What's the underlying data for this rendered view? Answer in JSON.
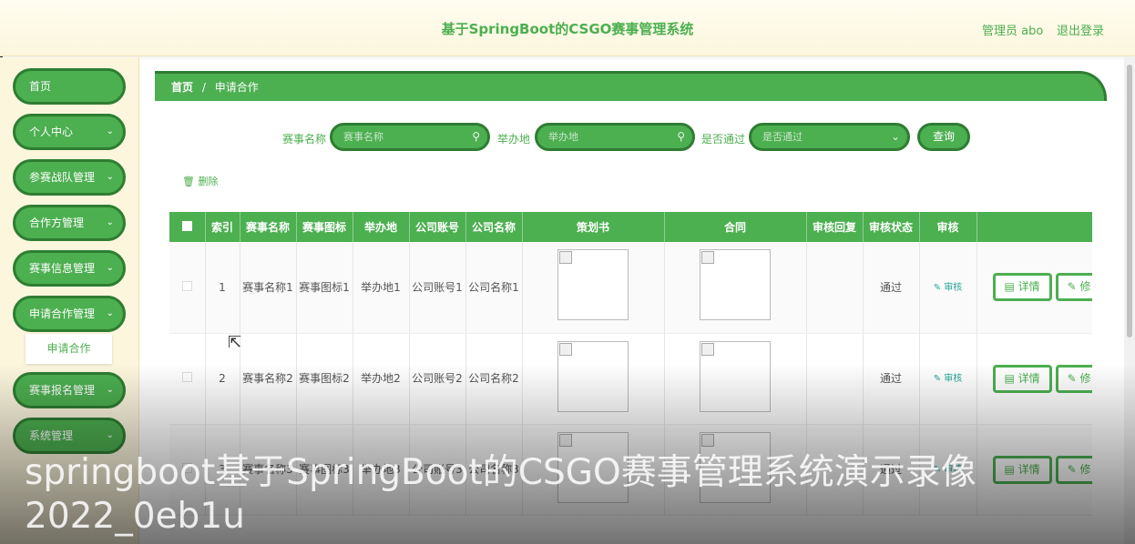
{
  "header": {
    "title": "基于SpringBoot的CSGO赛事管理系统",
    "user": "管理员 abo",
    "logout": "退出登录"
  },
  "sidebar": {
    "items": [
      {
        "label": "首页",
        "chevron": ""
      },
      {
        "label": "个人中心",
        "chevron": "⌄"
      },
      {
        "label": "参赛战队管理",
        "chevron": "⌄"
      },
      {
        "label": "合作方管理",
        "chevron": "⌄"
      },
      {
        "label": "赛事信息管理",
        "chevron": "⌄"
      },
      {
        "label": "申请合作管理",
        "chevron": "⌄"
      },
      {
        "label": "赛事报名管理",
        "chevron": "⌄"
      },
      {
        "label": "系统管理",
        "chevron": "⌄"
      }
    ],
    "submenu_active": "申请合作"
  },
  "breadcrumb": {
    "home": "首页",
    "sep": "/",
    "current": "申请合作"
  },
  "filters": {
    "event_name_label": "赛事名称",
    "event_name_placeholder": "赛事名称",
    "venue_label": "举办地",
    "venue_placeholder": "举办地",
    "passed_label": "是否通过",
    "passed_placeholder": "是否通过",
    "query_button": "查询"
  },
  "delete_button": "删除",
  "table": {
    "headers": [
      "索引",
      "赛事名称",
      "赛事图标",
      "举办地",
      "公司账号",
      "公司名称",
      "策划书",
      "合同",
      "审核回复",
      "审核状态",
      "审核",
      "操作"
    ],
    "rows": [
      {
        "index": "1",
        "name": "赛事名称1",
        "icon": "赛事图标1",
        "venue": "举办地1",
        "account": "公司账号1",
        "company": "公司名称1",
        "reply": "",
        "status": "通过"
      },
      {
        "index": "2",
        "name": "赛事名称2",
        "icon": "赛事图标2",
        "venue": "举办地2",
        "account": "公司账号2",
        "company": "公司名称2",
        "reply": "",
        "status": "通过"
      },
      {
        "index": "3",
        "name": "赛事名称3",
        "icon": "赛事图标3",
        "venue": "举办地3",
        "account": "公司账号3",
        "company": "公司名称3",
        "reply": "",
        "status": "通过"
      }
    ],
    "audit_link": "审核",
    "detail_button": "详情",
    "edit_button": "修"
  },
  "caption": "springboot基于SpringBoot的CSGO赛事管理系统演示录像2022_0eb1u",
  "colors": {
    "accent": "#4caf50",
    "accent_dark": "#2e7d32",
    "header_bg": "#fcf6dd"
  }
}
